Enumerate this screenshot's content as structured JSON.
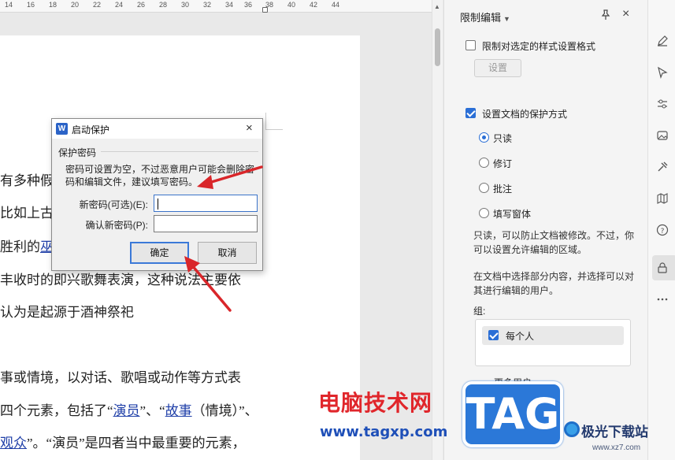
{
  "ruler": {
    "numbers": [
      "14",
      "16",
      "18",
      "20",
      "22",
      "24",
      "26",
      "28",
      "30",
      "32",
      "34",
      "36",
      "38",
      "40",
      "42",
      "44"
    ]
  },
  "document": {
    "lines": {
      "l1": "有多种假",
      "l2": "比如上古",
      "l3_pre": "胜利的",
      "l3_link": "巫",
      "l4": "丰收时的即兴歌舞表演，这种说法主要依",
      "l5": "认为是起源于酒神祭祀",
      "l6": "事或情境，以对话、歌唱或动作等方式表",
      "l7_pre": "四个元素，包括了“",
      "l7_link1": "演员",
      "l7_mid": "”、“",
      "l7_link2": "故事",
      "l7_post": "（情境）”、",
      "l8_link": "观众",
      "l8_post": "”。“演员”是四者当中最重要的元素，"
    }
  },
  "dialog": {
    "title": "启动保护",
    "close": "×",
    "group_label": "保护密码",
    "hint": "密码可设置为空，不过恶意用户可能会删除密码和编辑文件，建议填写密码。",
    "new_password_label": "新密码(可选)(E):",
    "new_password_value": "",
    "confirm_password_label": "确认新密码(P):",
    "confirm_password_value": "",
    "ok_label": "确定",
    "cancel_label": "取消"
  },
  "panel": {
    "title": "限制编辑",
    "close": "×",
    "restrict_format_label": "限制对选定的样式设置格式",
    "restrict_format_checked": false,
    "settings_button": "设置",
    "protect_label": "设置文档的保护方式",
    "protect_checked": true,
    "options": [
      "只读",
      "修订",
      "批注",
      "填写窗体"
    ],
    "selected_option": "只读",
    "desc1": "只读，可以防止文档被修改。不过，你可以设置允许编辑的区域。",
    "desc2": "在文档中选择部分内容，并选择可以对其进行编辑的用户。",
    "group_label": "组:",
    "group_item": "每个人",
    "group_item_checked": true,
    "more_users": "更多用户"
  },
  "watermark": {
    "site_cn": "电脑技术网",
    "site_url": "www.tagxp.com",
    "tag": "TAG",
    "jg_name": "极光下载站",
    "jg_url": "www.xz7.com"
  },
  "colors": {
    "accent": "#2b6fd6",
    "arrow": "#d9262a",
    "link": "#1f3fa8"
  }
}
